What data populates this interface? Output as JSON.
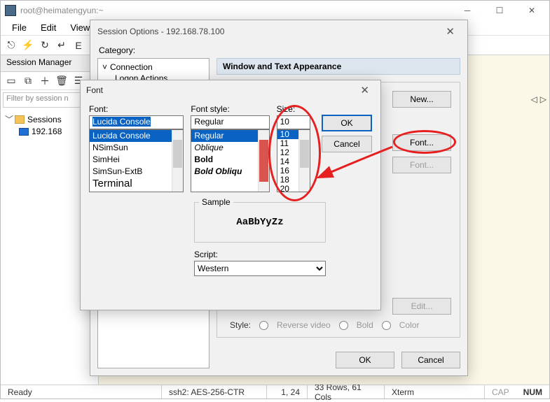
{
  "window": {
    "title": "root@heimatengyun:~"
  },
  "menu": {
    "file": "File",
    "edit": "Edit",
    "view": "View"
  },
  "session_manager": {
    "tab": "Session Manager",
    "filter_placeholder": "Filter by session n",
    "root": "Sessions",
    "item": "192.168"
  },
  "statusbar": {
    "ready": "Ready",
    "ssh": "ssh2: AES-256-CTR",
    "pos": "1,  24",
    "size": "33 Rows, 61 Cols",
    "term": "Xterm",
    "cap": "CAP",
    "num": "NUM"
  },
  "session_options": {
    "title": "Session Options - 192.168.78.100",
    "category_label": "Category:",
    "tree_connection": "Connection",
    "tree_logon": "Logon Actions",
    "section": "Window and Text Appearance",
    "new_btn": "New...",
    "font_btn": "Font...",
    "font_btn2": "Font...",
    "edit_btn": "Edit...",
    "style_label": "Style:",
    "style_opts": {
      "rev": "Reverse video",
      "bold": "Bold",
      "color": "Color"
    },
    "ok": "OK",
    "cancel": "Cancel"
  },
  "font_dialog": {
    "title": "Font",
    "font_label": "Font:",
    "style_label": "Font style:",
    "size_label": "Size:",
    "font_value": "Lucida Console",
    "style_value": "Regular",
    "size_value": "10",
    "fonts": [
      "Lucida Console",
      "NSimSun",
      "SimHei",
      "SimSun-ExtB",
      "Terminal"
    ],
    "styles": [
      "Regular",
      "Oblique",
      "Bold",
      "Bold Obliqu"
    ],
    "sizes": [
      "10",
      "11",
      "12",
      "14",
      "16",
      "18",
      "20"
    ],
    "ok": "OK",
    "cancel": "Cancel",
    "sample_label": "Sample",
    "sample_text": "AaBbYyZz",
    "script_label": "Script:",
    "script_value": "Western"
  }
}
